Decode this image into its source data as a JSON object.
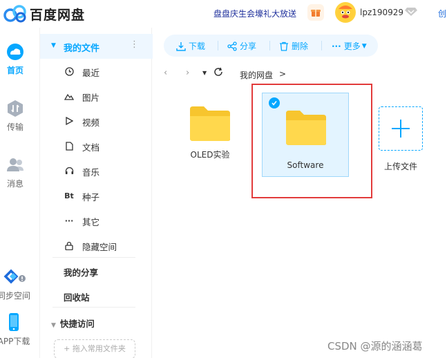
{
  "header": {
    "app_name": "百度网盘",
    "promo": "盘盘庆生会壕礼大放送",
    "username": "lpz190929",
    "create_label": "创"
  },
  "rail": {
    "home": "首页",
    "transfer": "传输",
    "messages": "消息",
    "sync": "同步空间",
    "app_download": "APP下载"
  },
  "sidebar": {
    "my_files": "我的文件",
    "items": [
      {
        "label": "最近",
        "icon": "clock-icon"
      },
      {
        "label": "图片",
        "icon": "image-icon"
      },
      {
        "label": "视频",
        "icon": "play-icon"
      },
      {
        "label": "文档",
        "icon": "document-icon"
      },
      {
        "label": "音乐",
        "icon": "headphones-icon"
      },
      {
        "label": "种子",
        "icon": "bt-icon",
        "glyph": "Bt"
      },
      {
        "label": "其它",
        "icon": "ellipsis-icon"
      },
      {
        "label": "隐藏空间",
        "icon": "lock-icon"
      }
    ],
    "my_share": "我的分享",
    "recycle_bin": "回收站",
    "quick_access": "快捷访问",
    "drop_hint": "+ 拖入常用文件夹"
  },
  "toolbar": {
    "download": "下载",
    "share": "分享",
    "delete": "删除",
    "more": "更多"
  },
  "breadcrumb": {
    "root": "我的网盘",
    "separator": ">"
  },
  "files": [
    {
      "name": "OLED实验",
      "type": "folder",
      "selected": false
    },
    {
      "name": "Software",
      "type": "folder",
      "selected": true
    }
  ],
  "upload_label": "上传文件",
  "watermark": "CSDN @源的涵涵葛",
  "colors": {
    "accent": "#06a7ff",
    "folder": "#ffd54a",
    "selection_bg": "#e3f4ff",
    "highlight_border": "#e23b3b"
  }
}
